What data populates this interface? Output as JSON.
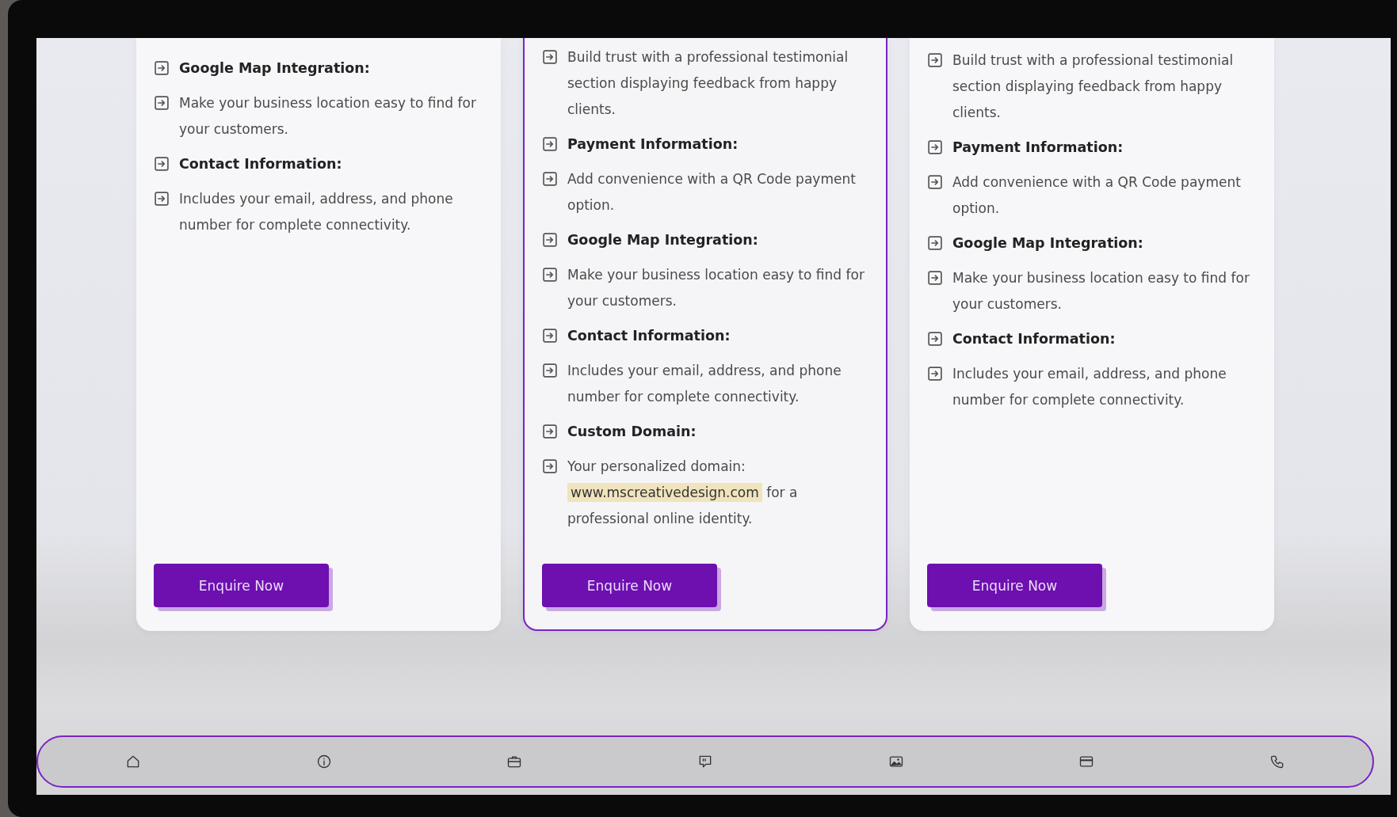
{
  "plans": [
    {
      "featured": false,
      "items": [
        {
          "kind": "heading",
          "text": "Google Map Integration:"
        },
        {
          "kind": "text",
          "text": "Make your business location easy to find for your customers."
        },
        {
          "kind": "heading",
          "text": "Contact Information:"
        },
        {
          "kind": "text",
          "text": "Includes your email, address, and phone number for complete connectivity."
        }
      ],
      "button": "Enquire Now"
    },
    {
      "featured": true,
      "items": [
        {
          "kind": "text",
          "text": "Build trust with a professional testimonial section displaying feedback from happy clients."
        },
        {
          "kind": "heading",
          "text": "Payment Information:"
        },
        {
          "kind": "text",
          "text": "Add convenience with a QR Code payment option."
        },
        {
          "kind": "heading",
          "text": "Google Map Integration:"
        },
        {
          "kind": "text",
          "text": "Make your business location easy to find for your customers."
        },
        {
          "kind": "heading",
          "text": "Contact Information:"
        },
        {
          "kind": "text",
          "text": "Includes your email, address, and phone number for complete connectivity."
        },
        {
          "kind": "heading",
          "text": "Custom Domain:"
        },
        {
          "kind": "text",
          "text": "Your personalized domain:",
          "highlight": "www.mscreativedesign.com",
          "text_after": "for a professional online identity."
        }
      ],
      "button": "Enquire Now"
    },
    {
      "featured": false,
      "items": [
        {
          "kind": "text",
          "text": "Build trust with a professional testimonial section displaying feedback from happy clients."
        },
        {
          "kind": "heading",
          "text": "Payment Information:"
        },
        {
          "kind": "text",
          "text": "Add convenience with a QR Code payment option."
        },
        {
          "kind": "heading",
          "text": "Google Map Integration:"
        },
        {
          "kind": "text",
          "text": "Make your business location easy to find for your customers."
        },
        {
          "kind": "heading",
          "text": "Contact Information:"
        },
        {
          "kind": "text",
          "text": "Includes your email, address, and phone number for complete connectivity."
        }
      ],
      "button": "Enquire Now"
    }
  ]
}
